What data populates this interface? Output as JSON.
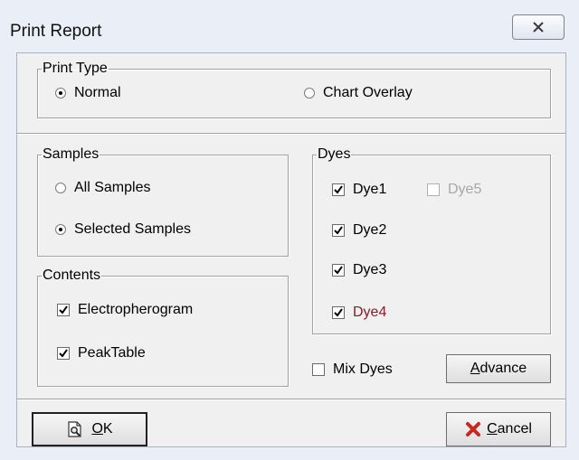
{
  "window": {
    "title": "Print Report",
    "close_glyph": "✕"
  },
  "print_type": {
    "legend": "Print Type",
    "options": [
      {
        "label": "Normal",
        "selected": true
      },
      {
        "label": "Chart Overlay",
        "selected": false
      }
    ]
  },
  "samples": {
    "legend": "Samples",
    "options": [
      {
        "label": "All Samples",
        "selected": false
      },
      {
        "label": "Selected Samples",
        "selected": true
      }
    ]
  },
  "contents": {
    "legend": "Contents",
    "items": [
      {
        "label": "Electropherogram",
        "checked": true
      },
      {
        "label": "PeakTable",
        "checked": true
      }
    ]
  },
  "dyes": {
    "legend": "Dyes",
    "items": [
      {
        "label": "Dye1",
        "checked": true,
        "enabled": true
      },
      {
        "label": "Dye5",
        "checked": false,
        "enabled": false
      },
      {
        "label": "Dye2",
        "checked": true,
        "enabled": true
      },
      {
        "label": "Dye3",
        "checked": true,
        "enabled": true
      },
      {
        "label": "Dye4",
        "checked": true,
        "enabled": true,
        "color": "#8b1a2b"
      }
    ]
  },
  "mix_dyes": {
    "label": "Mix Dyes",
    "checked": false
  },
  "buttons": {
    "advance": {
      "mnemonic": "A",
      "rest": "dvance"
    },
    "ok": {
      "mnemonic": "O",
      "rest": "K",
      "icon": "print-preview-icon"
    },
    "cancel": {
      "mnemonic": "C",
      "rest": "ancel",
      "icon": "red-x-icon"
    }
  },
  "colors": {
    "client_bg": "#f0f0f0",
    "frame_bg": "#e9eef7",
    "cancel_x": "#c8281e"
  }
}
